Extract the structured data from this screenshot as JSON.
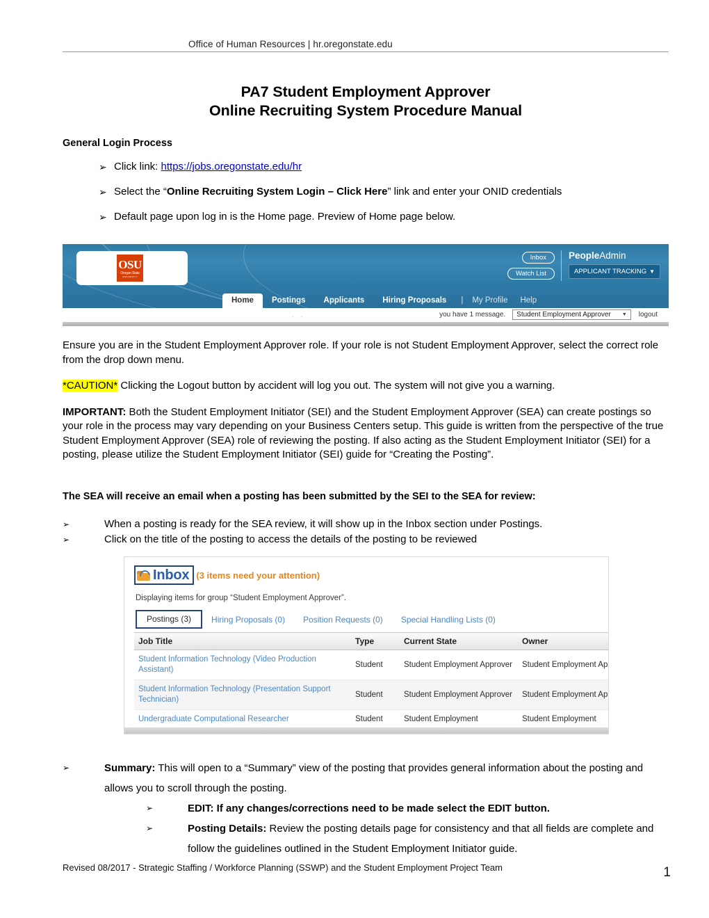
{
  "header": {
    "running_head": "Office of Human Resources | hr.oregonstate.edu"
  },
  "title": {
    "line1": "PA7 Student Employment Approver",
    "line2": "Online Recruiting System Procedure Manual"
  },
  "sections": {
    "general_login_heading": "General Login Process",
    "login_bullets": [
      {
        "prefix": "Click link: ",
        "link": "https://jobs.oregonstate.edu/hr"
      },
      {
        "pre": "Select the “",
        "bold": "Online Recruiting System Login – Click Here",
        "post": "” link and enter your ONID credentials"
      },
      {
        "text": "Default page upon log in is the Home page. Preview of Home page below."
      }
    ],
    "ensure_paragraph": "Ensure you are in the Student Employment Approver role. If your role is not Student Employment Approver, select the correct role from the drop down menu.",
    "caution_label": "*CAUTION*",
    "caution_text": " Clicking the Logout button by accident will log you out. The system will not give you a warning.",
    "important_label": "IMPORTANT:",
    "important_text": "  Both the Student Employment Initiator (SEI) and the Student Employment Approver (SEA) can create postings so your role in the process may vary depending on your Business Centers setup.  This guide is written from the perspective of the true Student Employment Approver (SEA) role of reviewing the posting.  If also acting as the Student Employment Initiator (SEI) for a posting, please utilize the Student Employment Initiator (SEI) guide for “Creating the Posting”.",
    "sea_email_heading": "The SEA will receive an email when a posting has been submitted by the SEI to the SEA for review:",
    "sea_bullets": [
      "When a posting is ready for the SEA review, it will show up in the Inbox section under Postings.",
      "Click on the title of the posting to access the details of the posting to be reviewed"
    ],
    "summary_label": "Summary:",
    "summary_text": " This will open to a “Summary” view of the posting that provides general information about the posting and allows you to scroll through the posting.",
    "edit_label": "EDIT:",
    "edit_text": "  If any changes/corrections need to be made select the EDIT button.",
    "posting_details_label": "Posting Details:",
    "posting_details_text": "  Review the posting details page for consistency and that all fields are complete and follow the guidelines outlined in the Student Employment Initiator guide."
  },
  "peopleadmin_banner": {
    "logo_main": "OSU",
    "logo_sub": "Oregon State",
    "logo_sub2": "UNIVERSITY",
    "inbox_pill": "Inbox",
    "watchlist_pill": "Watch List",
    "brand_bold": "People",
    "brand_light": "Admin",
    "module": "APPLICANT TRACKING",
    "module_caret": "▼",
    "nav": [
      "Home",
      "Postings",
      "Applicants",
      "Hiring Proposals"
    ],
    "nav_separator": "|",
    "nav_links": [
      "My Profile",
      "Help"
    ],
    "message": "you have 1 message.",
    "role_value": "Student Employment Approver",
    "role_caret": "▼",
    "logout": "logout"
  },
  "inbox_screenshot": {
    "title": "Inbox",
    "attention": "(3 items need your attention)",
    "subtitle": "Displaying items for group “Student Employment Approver”.",
    "tabs": [
      "Postings (3)",
      "Hiring Proposals (0)",
      "Position Requests (0)",
      "Special Handling Lists (0)"
    ],
    "columns": [
      "Job Title",
      "Type",
      "Current State",
      "Owner"
    ],
    "rows": [
      {
        "job_title": "Student Information Technology (Video Production Assistant)",
        "type": "Student",
        "current_state": "Student Employment Approver",
        "owner": "Student Employment Approver"
      },
      {
        "job_title": "Student Information Technology (Presentation Support Technician)",
        "type": "Student",
        "current_state": "Student Employment Approver",
        "owner": "Student Employment Approver"
      },
      {
        "job_title": "Undergraduate Computational Researcher",
        "type": "Student",
        "current_state": "Student Employment",
        "owner": "Student Employment"
      }
    ]
  },
  "footer": {
    "text": "Revised 08/2017 - Strategic Staffing / Workforce Planning (SSWP) and the Student Employment Project Team",
    "page_number": "1"
  },
  "colors": {
    "link": "#0000cc",
    "highlight": "#ffff00",
    "osu_orange": "#d73f09",
    "banner_blue": "#2f7aa5",
    "inbox_title_blue": "#2a5fa5",
    "inbox_orange": "#e8851b",
    "annotation_box": "#26447a"
  },
  "icons": {
    "bullet_arrow": "➢",
    "folder": "inbox-folder-icon"
  }
}
